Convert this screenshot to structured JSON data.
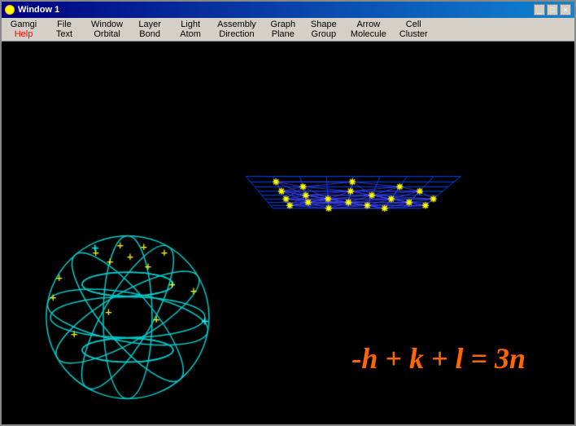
{
  "window": {
    "title": "Window 1",
    "title_icon": "window-icon"
  },
  "titlebar": {
    "buttons": [
      "minimize",
      "maximize",
      "close"
    ]
  },
  "menu": {
    "columns": [
      {
        "top": "Gamgi",
        "bottom": "Help",
        "bottom_red": true
      },
      {
        "top": "File",
        "bottom": "Text"
      },
      {
        "top": "Window",
        "bottom": "Orbital"
      },
      {
        "top": "Layer",
        "bottom": "Bond"
      },
      {
        "top": "Light",
        "bottom": "Atom"
      },
      {
        "top": "Assembly",
        "bottom": "Direction"
      },
      {
        "top": "Graph",
        "bottom": "Plane"
      },
      {
        "top": "Shape",
        "bottom": "Group"
      },
      {
        "top": "Arrow",
        "bottom": "Molecule"
      },
      {
        "top": "Cell",
        "bottom": "Cluster"
      }
    ]
  },
  "formula": {
    "text": "-h + k + l = 3n"
  },
  "visualization": {
    "grid_color": "#0000ff",
    "sphere_color": "#00ffff",
    "node_color": "#ffff00",
    "background": "#000000"
  }
}
